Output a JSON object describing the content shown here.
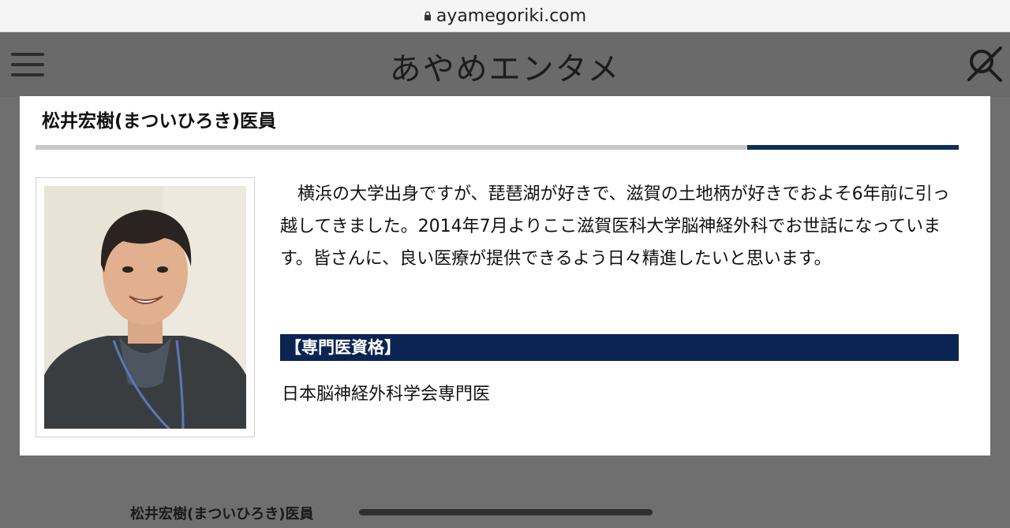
{
  "browser": {
    "url": "ayamegoriki.com"
  },
  "header": {
    "site_title": "あやめエンタメ",
    "menu_icon": "hamburger-menu-icon",
    "close_search_icon": "search-close-icon"
  },
  "card": {
    "title": "松井宏樹(まついひろき)医員",
    "bio": "横浜の大学出身ですが、琵琶湖が好きで、滋賀の土地柄が好きでおよそ6年前に引っ越してきました。2014年7月よりここ滋賀医科大学脳神経外科でお世話になっています。皆さんに、良い医療が提供できるよう日々精進したいと思います。",
    "qualification_heading": "【専門医資格】",
    "qualification_value": "日本脳神経外科学会専門医",
    "photo_icon": "doctor-portrait-photo"
  },
  "caption": {
    "text": "松井宏樹(まついひろき)医員"
  },
  "colors": {
    "accent": "#0b2452",
    "rule_gray": "#c8c8c8",
    "overlay_gray": "#6f6f6f"
  }
}
